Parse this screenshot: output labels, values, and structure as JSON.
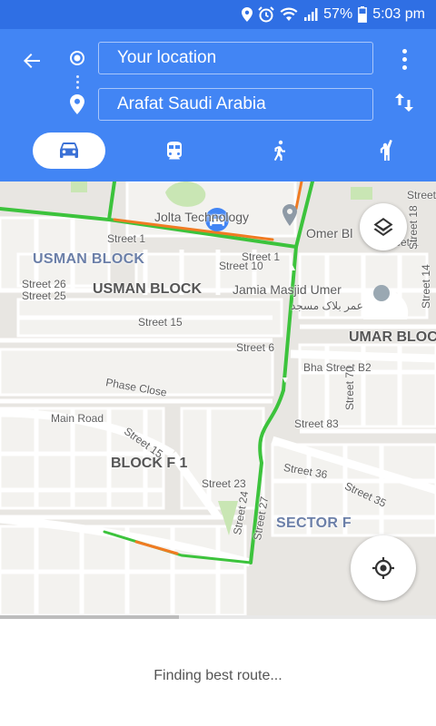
{
  "status_bar": {
    "battery": "57%",
    "time": "5:03 pm",
    "icons": [
      "location-icon",
      "alarm-icon",
      "wifi-icon",
      "signal-icon",
      "battery-icon"
    ]
  },
  "directions": {
    "origin": "Your location",
    "destination": "Arafat Saudi Arabia",
    "modes": [
      {
        "name": "drive",
        "icon": "car-icon",
        "active": true
      },
      {
        "name": "transit",
        "icon": "train-icon",
        "active": false
      },
      {
        "name": "walk",
        "icon": "walk-icon",
        "active": false
      },
      {
        "name": "ride",
        "icon": "ride-hail-icon",
        "active": false
      }
    ]
  },
  "map": {
    "labels": {
      "jolta": "Jolta Technology",
      "omer": "Omer Bl",
      "usman_block_1": "USMAN BLOCK",
      "usman_block_2": "USMAN BLOCK",
      "jamia": "Jamia Masjid Umer",
      "jamia_ar": "عمر بلاک مسجد",
      "umar_block": "UMAR BLOC",
      "block_f1": "BLOCK F 1",
      "sector_f": "SECTOR F",
      "street_1a": "Street 1",
      "street_1b": "Street 1",
      "street_1c": "Street 1",
      "street_10": "Street 10",
      "street_26": "Street 26",
      "street_25": "Street 25",
      "street_15a": "Street 15",
      "street_6": "Street 6",
      "street_18": "Street 18",
      "street_14": "Street 14",
      "bha_street": "Bha Street B2",
      "phase_close": "Phase Close",
      "main_road": "Main Road",
      "street_15b": "Street 15",
      "street_70": "Street 70",
      "street_83": "Street 83",
      "street_36": "Street 36",
      "street_35": "Street 35",
      "street_23": "Street 23",
      "street_24": "Street 24",
      "street_27": "Street 27",
      "street_top": "Street"
    }
  },
  "bottom": {
    "status_text": "Finding best route...",
    "progress": 0.41
  },
  "colors": {
    "header": "#4285f4",
    "status_bar": "#2f6fe4",
    "route_green": "#3cc33c",
    "route_orange": "#f07b22"
  }
}
